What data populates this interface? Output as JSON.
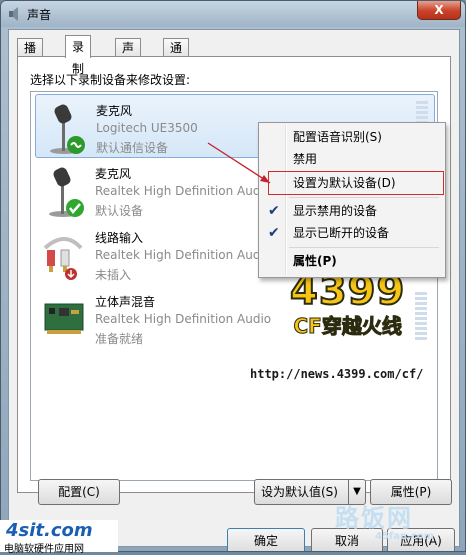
{
  "window": {
    "title": "声音",
    "close_label": "X"
  },
  "tabs": [
    {
      "label": "播放"
    },
    {
      "label": "录制"
    },
    {
      "label": "声音"
    },
    {
      "label": "通信"
    }
  ],
  "instruction": "选择以下录制设备来修改设置:",
  "devices": [
    {
      "name": "麦克风",
      "driver": "Logitech UE3500",
      "status": "默认通信设备",
      "icon": "microphone-icon"
    },
    {
      "name": "麦克风",
      "driver": "Realtek High Definition Audio",
      "status": "默认设备",
      "icon": "microphone-icon"
    },
    {
      "name": "线路输入",
      "driver": "Realtek High Definition Audio",
      "status": "未插入",
      "icon": "line-in-cable-icon"
    },
    {
      "name": "立体声混音",
      "driver": "Realtek High Definition Audio",
      "status": "准备就绪",
      "icon": "sound-card-icon"
    }
  ],
  "context_menu": {
    "items": [
      {
        "label": "配置语音识别(S)"
      },
      {
        "label": "禁用"
      },
      {
        "label": "设置为默认设备(D)"
      },
      {
        "label": "显示禁用的设备",
        "checked": true
      },
      {
        "label": "显示已断开的设备",
        "checked": true
      },
      {
        "label": "属性(P)"
      }
    ]
  },
  "buttons": {
    "configure": "配置(C)",
    "set_default": "设为默认值(S)",
    "properties": "属性(P)",
    "ok": "确定",
    "cancel": "取消",
    "apply": "应用(A)"
  },
  "watermark": {
    "logo_top": "4399",
    "logo_sub": "CF穿越火线",
    "url": "http://news.4399.com/cf/",
    "left_brand": "4sit.com",
    "left_brand_sub": "电脑软硬件应用网",
    "right_brand": "路饭网",
    "right_brand_sub": "45fan.com"
  },
  "colors": {
    "accent": "#1d3e7b",
    "highlight_box": "#d12b2b",
    "selected_bg": "#d5e7f8"
  }
}
